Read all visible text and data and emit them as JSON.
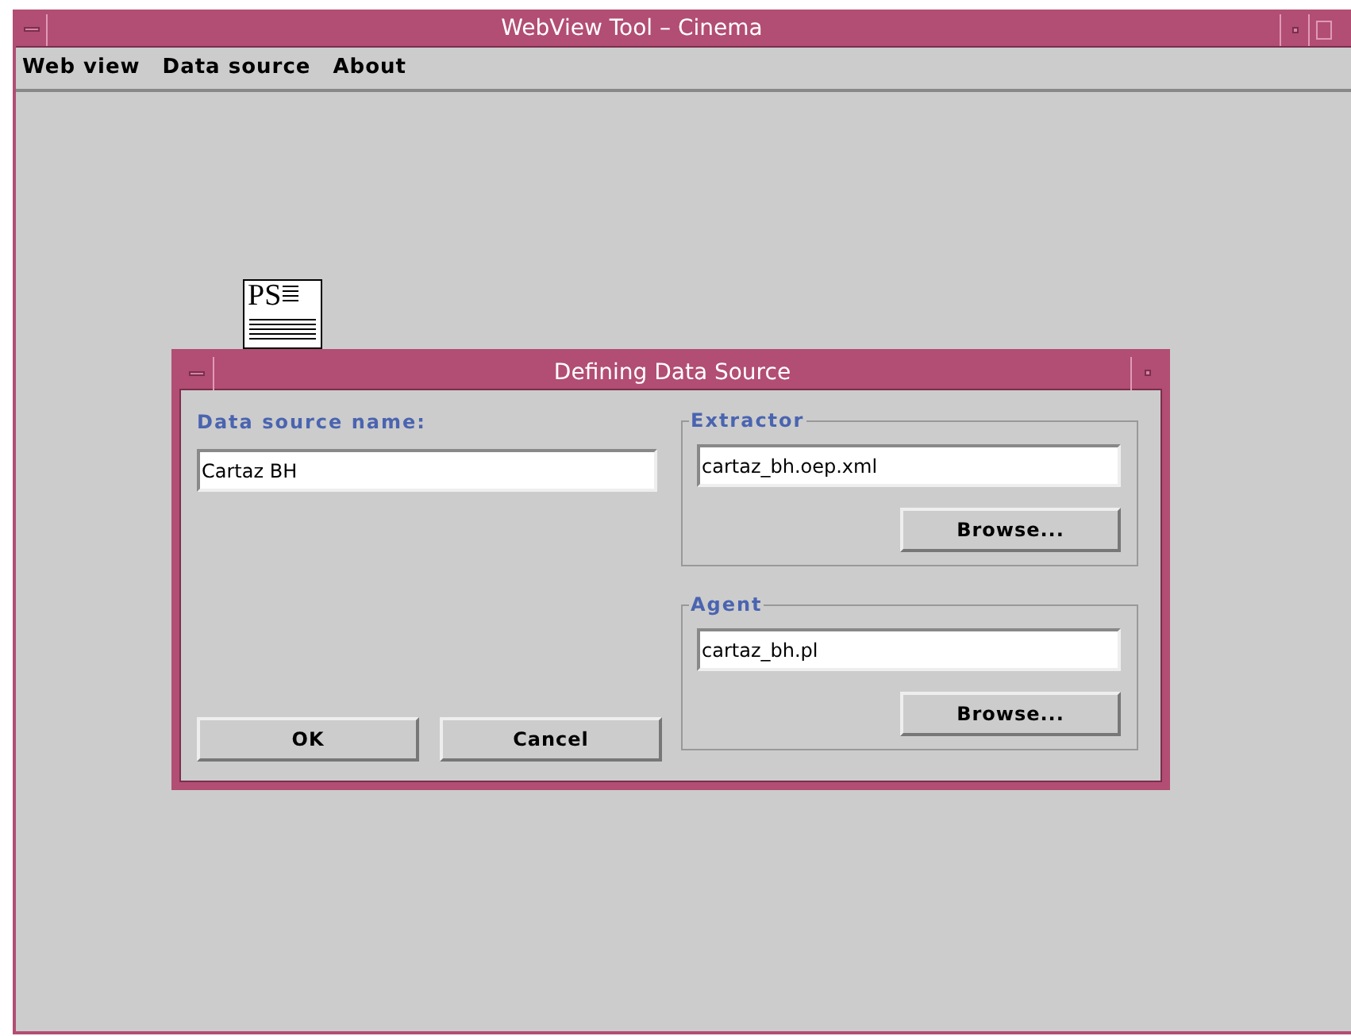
{
  "window": {
    "title": "WebView Tool – Cinema"
  },
  "menu": [
    {
      "label": "Web view"
    },
    {
      "label": "Data source"
    },
    {
      "label": "About"
    }
  ],
  "desktop_icon": {
    "label": "PS"
  },
  "dialog": {
    "title": "Defining Data Source",
    "name_label": "Data source name:",
    "name_value": "Cartaz BH",
    "buttons": [
      {
        "label": "OK"
      },
      {
        "label": "Cancel"
      }
    ],
    "groups": [
      {
        "title": "Extractor",
        "value": "cartaz_bh.oep.xml",
        "button": "Browse..."
      },
      {
        "title": "Agent",
        "value": "cartaz_bh.pl",
        "button": "Browse..."
      }
    ]
  }
}
